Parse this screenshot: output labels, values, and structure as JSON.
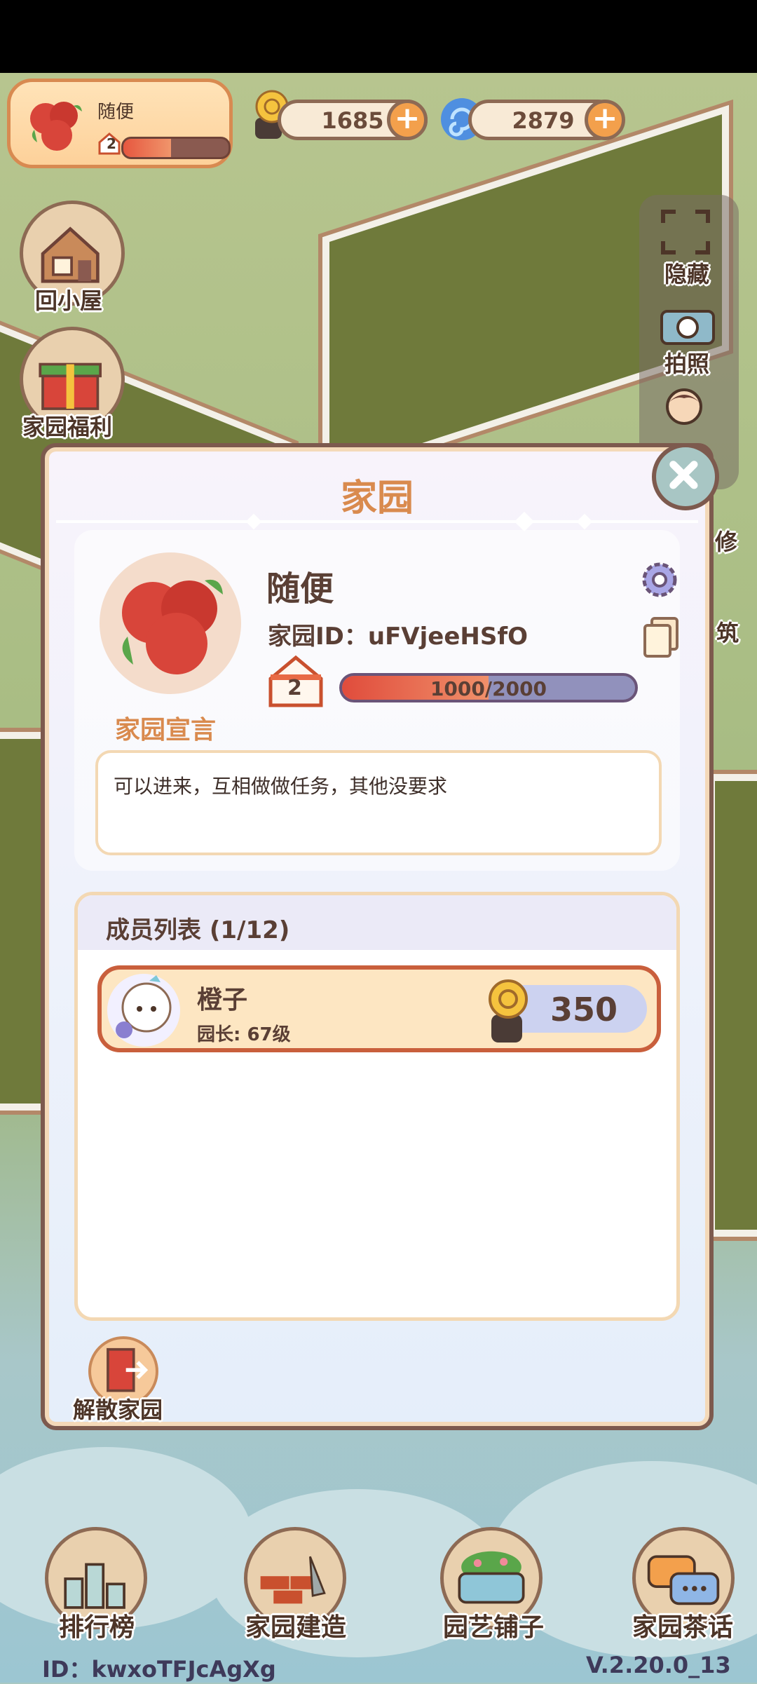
{
  "header": {
    "home_name": "随便",
    "home_level": "2",
    "home_level_progress": 0.45,
    "resources": [
      {
        "icon": "snail-coin-icon",
        "value": "1685"
      },
      {
        "icon": "spiral-gem-icon",
        "value": "2879"
      }
    ]
  },
  "left_buttons": [
    {
      "label": "回小屋",
      "icon": "house-icon"
    },
    {
      "label": "家园福利",
      "icon": "gift-box-icon"
    }
  ],
  "right_buttons": [
    {
      "label": "隐藏",
      "icon": "fullscreen-frame-icon"
    },
    {
      "label": "拍照",
      "icon": "camera-icon"
    },
    {
      "label": "修",
      "icon": "character-icon"
    },
    {
      "label": "筑",
      "icon": "build-icon"
    }
  ],
  "dialog": {
    "title": "家园",
    "name": "随便",
    "id_label": "家园ID：uFVjeeHSfO",
    "level": "2",
    "exp_text": "1000/2000",
    "exp_progress": 0.5,
    "manifesto_label": "家园宣言",
    "manifesto": "可以进来，互相做做任务，其他没要求",
    "members_title": "成员列表 (1/12)",
    "members": [
      {
        "name": "橙子",
        "role": "园长: 67级",
        "score": "350"
      }
    ],
    "dissolve_label": "解散家园"
  },
  "bottom_nav": [
    {
      "label": "排行榜",
      "icon": "leaderboard-icon"
    },
    {
      "label": "家园建造",
      "icon": "brick-trowel-icon"
    },
    {
      "label": "园艺铺子",
      "icon": "planter-icon"
    },
    {
      "label": "家园茶话",
      "icon": "chat-bubbles-icon"
    }
  ],
  "footer": {
    "user_id": "ID：kwxoTFJcAgXg",
    "version": "V.2.20.0_13"
  },
  "colors": {
    "accent_orange": "#d98a4e",
    "text_brown": "#5a3f35",
    "border_brown": "#7d5a4e",
    "exp_fill": "#e04c3c"
  }
}
